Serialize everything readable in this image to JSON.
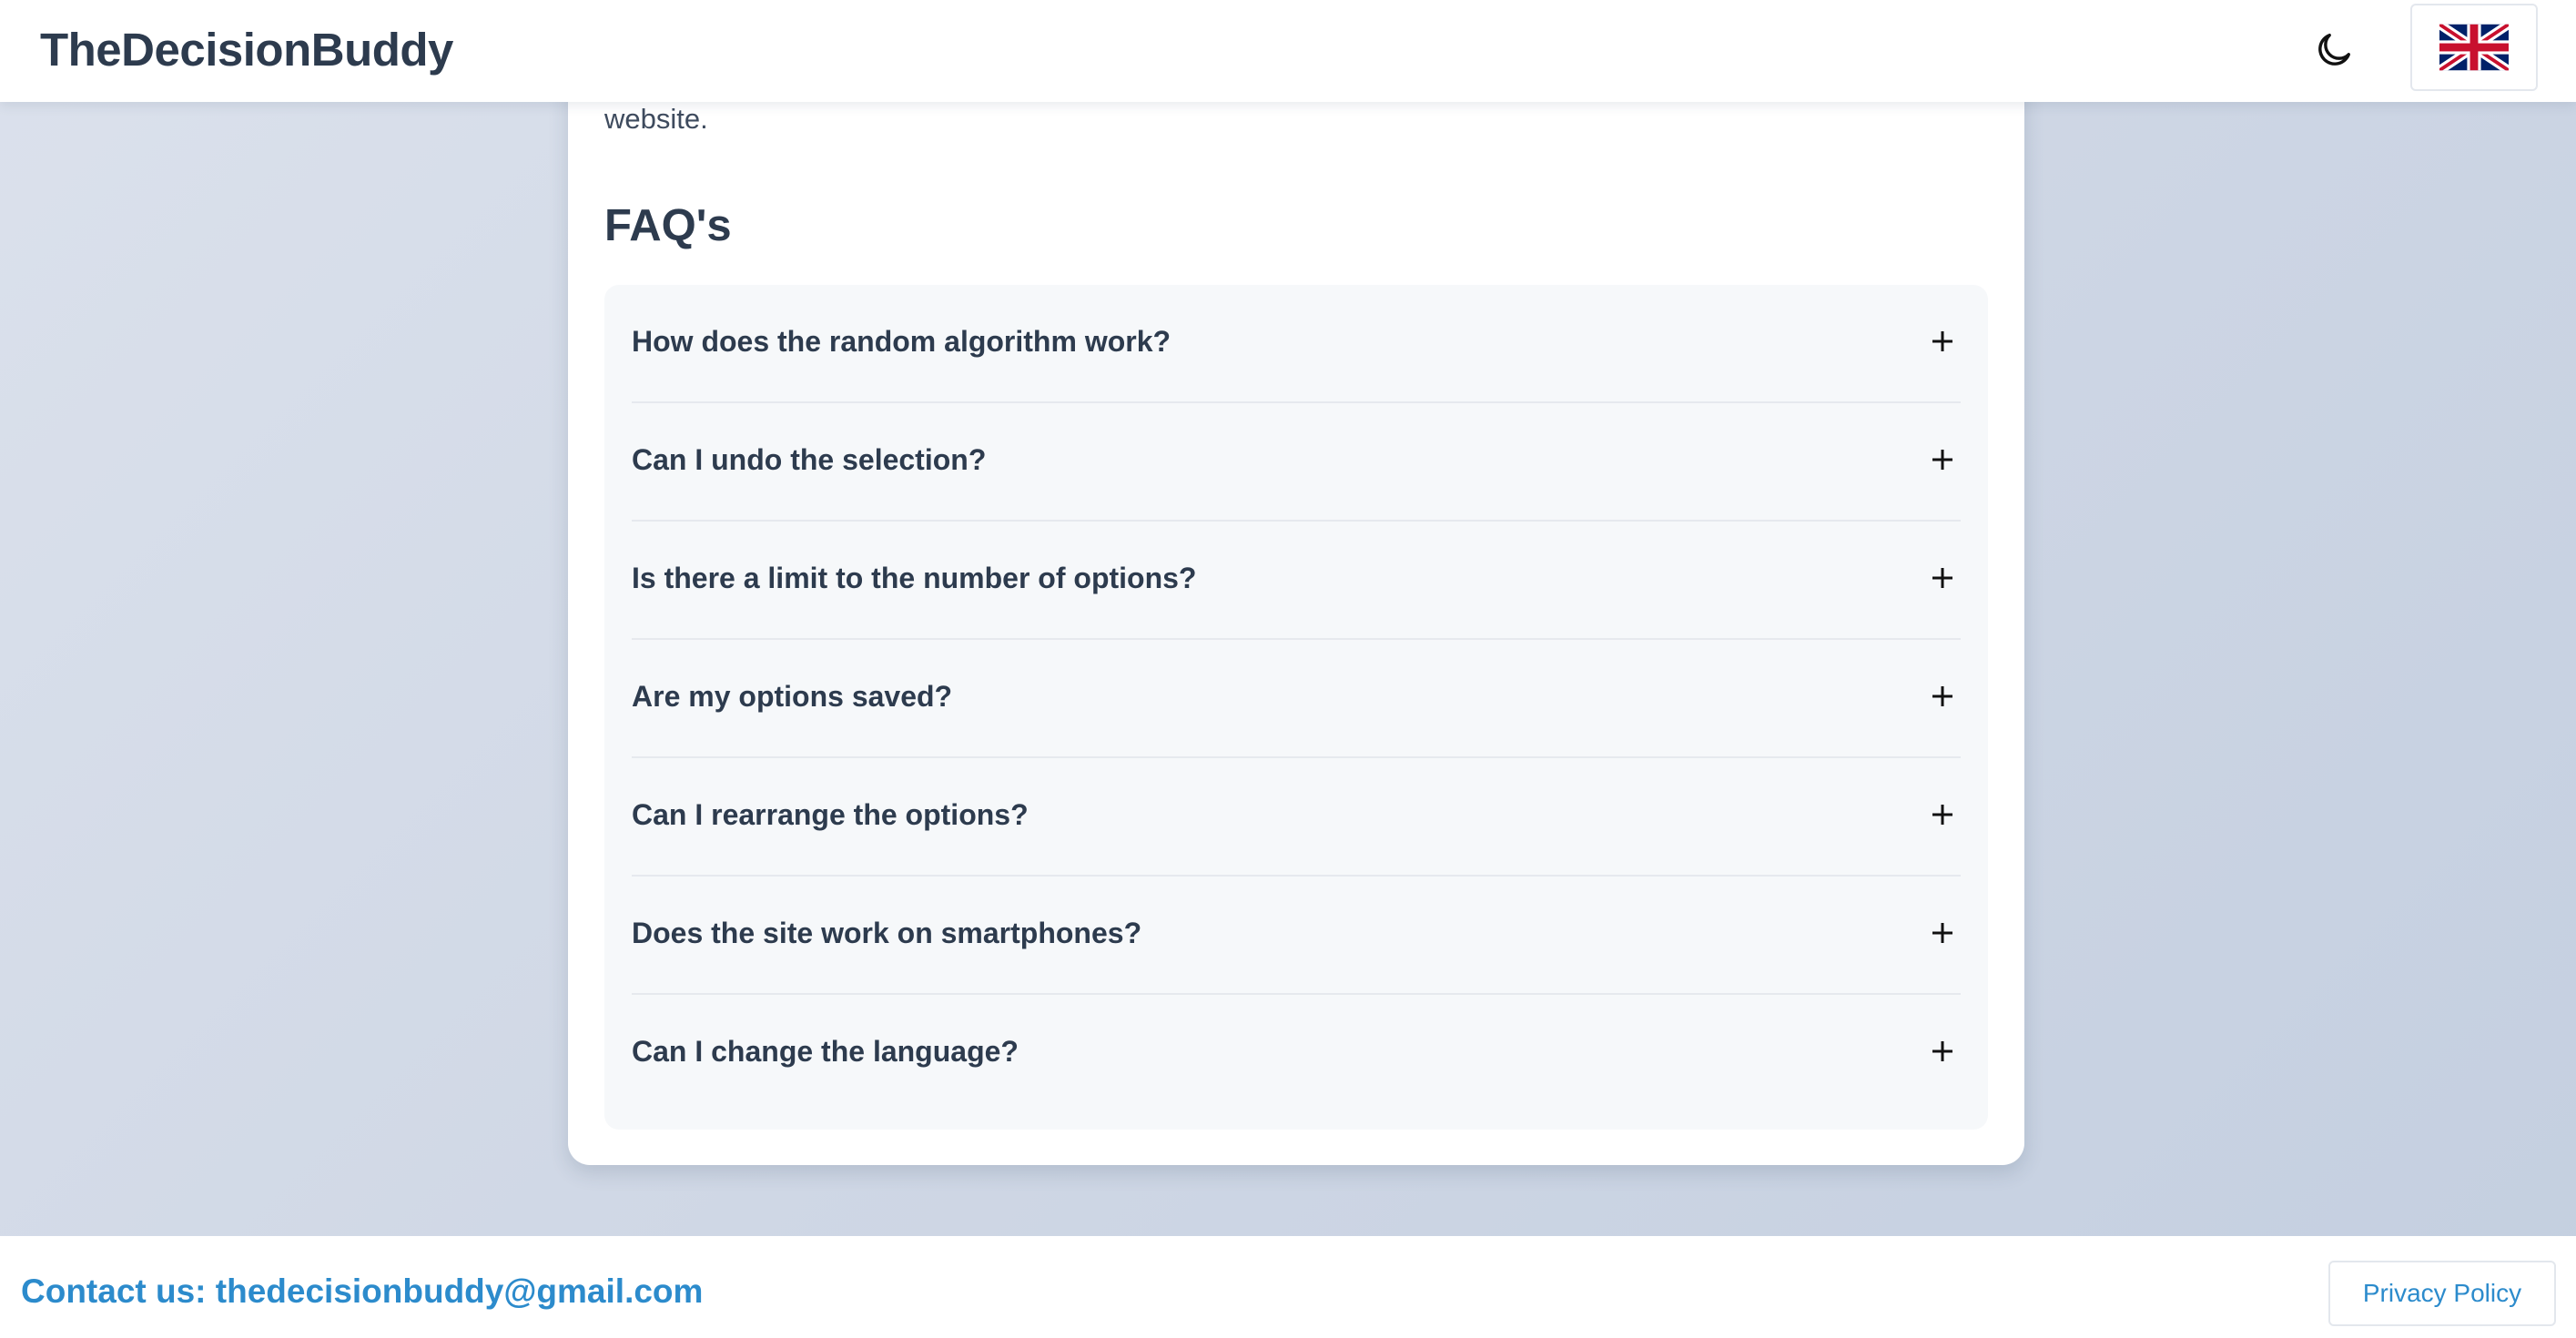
{
  "header": {
    "brand": "TheDecisionBuddy",
    "theme_toggle_icon": "moon-icon",
    "language_icon": "uk-flag-icon"
  },
  "main": {
    "intro_tail": "website.",
    "faq_title": "FAQ's",
    "faq_items": [
      {
        "question": "How does the random algorithm work?",
        "icon": "plus-icon"
      },
      {
        "question": "Can I undo the selection?",
        "icon": "plus-icon"
      },
      {
        "question": "Is there a limit to the number of options?",
        "icon": "plus-icon"
      },
      {
        "question": "Are my options saved?",
        "icon": "plus-icon"
      },
      {
        "question": "Can I rearrange the options?",
        "icon": "plus-icon"
      },
      {
        "question": "Does the site work on smartphones?",
        "icon": "plus-icon"
      },
      {
        "question": "Can I change the language?",
        "icon": "plus-icon"
      }
    ]
  },
  "footer": {
    "contact": "Contact us: thedecisionbuddy@gmail.com",
    "privacy_label": "Privacy Policy"
  },
  "colors": {
    "text": "#2d3b4e",
    "link": "#2c8bcc",
    "faq_bg": "#f6f8fa"
  }
}
